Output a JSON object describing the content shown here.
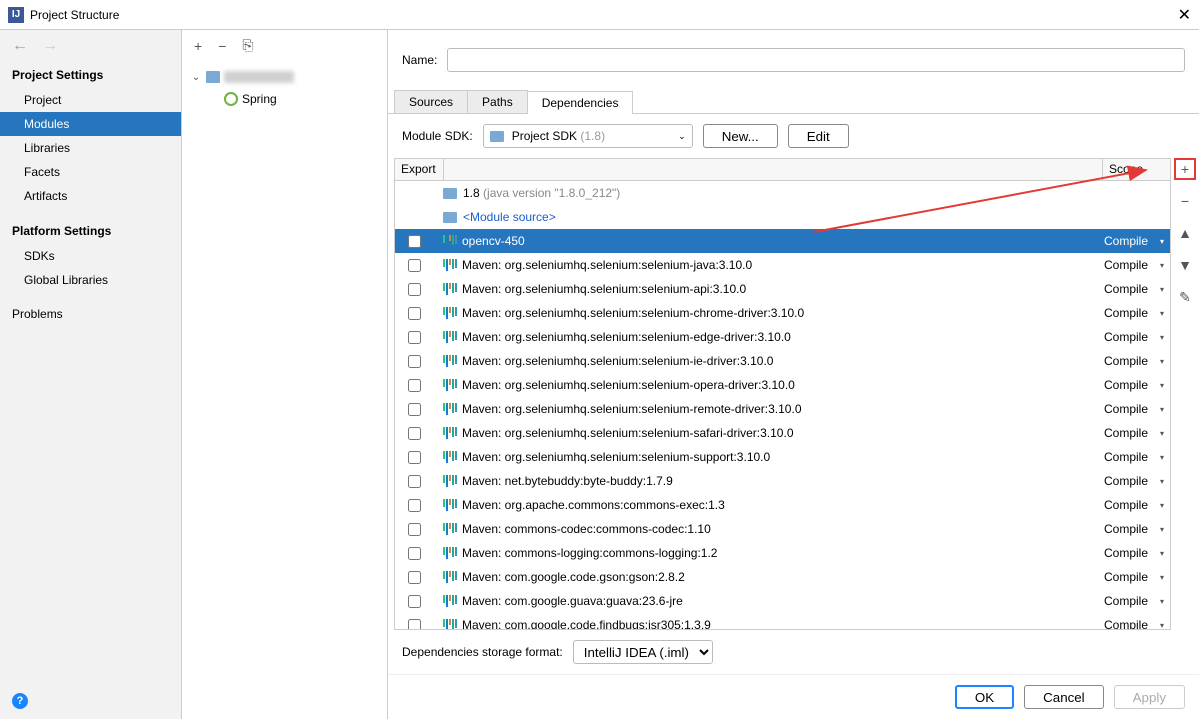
{
  "window": {
    "title": "Project Structure"
  },
  "sidebar": {
    "section1": "Project Settings",
    "section2": "Platform Settings",
    "items": {
      "project": "Project",
      "modules": "Modules",
      "libraries": "Libraries",
      "facets": "Facets",
      "artifacts": "Artifacts",
      "sdks": "SDKs",
      "globalLibraries": "Global Libraries",
      "problems": "Problems"
    }
  },
  "tree": {
    "springLabel": "Spring"
  },
  "detail": {
    "nameLabel": "Name:",
    "tabs": {
      "sources": "Sources",
      "paths": "Paths",
      "dependencies": "Dependencies"
    },
    "sdkLabel": "Module SDK:",
    "sdkName": "Project SDK",
    "sdkVersion": "(1.8)",
    "newBtn": "New...",
    "editBtn": "Edit",
    "colExport": "Export",
    "colScope": "Scope",
    "jdk": {
      "name": "1.8",
      "ver": "(java version \"1.8.0_212\")"
    },
    "moduleSource": "<Module source>",
    "compile": "Compile",
    "deps": [
      "opencv-450",
      "Maven: org.seleniumhq.selenium:selenium-java:3.10.0",
      "Maven: org.seleniumhq.selenium:selenium-api:3.10.0",
      "Maven: org.seleniumhq.selenium:selenium-chrome-driver:3.10.0",
      "Maven: org.seleniumhq.selenium:selenium-edge-driver:3.10.0",
      "Maven: org.seleniumhq.selenium:selenium-ie-driver:3.10.0",
      "Maven: org.seleniumhq.selenium:selenium-opera-driver:3.10.0",
      "Maven: org.seleniumhq.selenium:selenium-remote-driver:3.10.0",
      "Maven: org.seleniumhq.selenium:selenium-safari-driver:3.10.0",
      "Maven: org.seleniumhq.selenium:selenium-support:3.10.0",
      "Maven: net.bytebuddy:byte-buddy:1.7.9",
      "Maven: org.apache.commons:commons-exec:1.3",
      "Maven: commons-codec:commons-codec:1.10",
      "Maven: commons-logging:commons-logging:1.2",
      "Maven: com.google.code.gson:gson:2.8.2",
      "Maven: com.google.guava:guava:23.6-jre",
      "Maven: com.google.code.findbugs:jsr305:1.3.9"
    ],
    "storageLabel": "Dependencies storage format:",
    "storageValue": "IntelliJ IDEA (.iml)"
  },
  "footer": {
    "ok": "OK",
    "cancel": "Cancel",
    "apply": "Apply"
  }
}
